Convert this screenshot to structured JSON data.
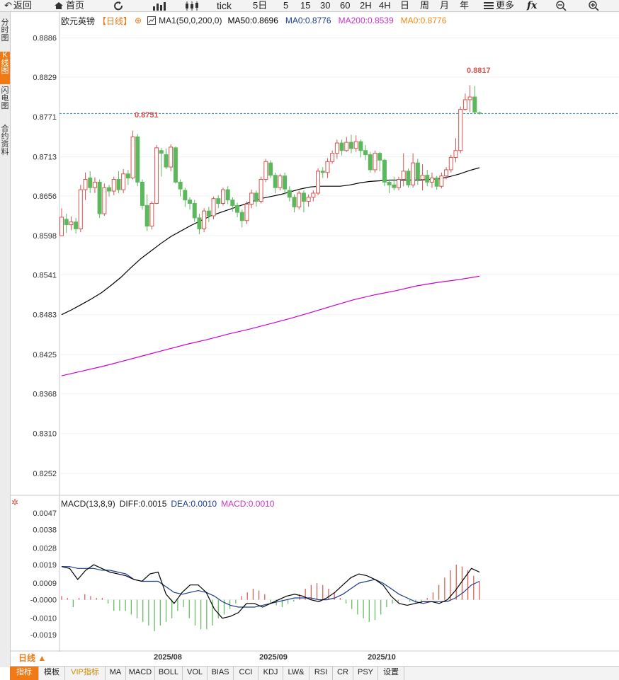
{
  "toolbar": {
    "back": "返回",
    "home": "首页",
    "tick": "tick",
    "periods": [
      "5日",
      "5",
      "15",
      "30",
      "60",
      "2H",
      "4H",
      "日",
      "周",
      "月",
      "年"
    ],
    "more": "更多"
  },
  "sidebar": [
    {
      "label": "分时图",
      "active": false
    },
    {
      "label": "K线图",
      "active": true
    },
    {
      "label": "闪电图",
      "active": false
    },
    {
      "label": "合约资料",
      "active": false
    }
  ],
  "legend": {
    "symbol": "欧元英镑",
    "period": "【日线】",
    "ma1": "MA1(50,0,200,0)",
    "ma50": "MA50:0.8696",
    "ma0": "MA0:0.8776",
    "ma200": "MA200:0.8539",
    "ma0b": "MA0:0.8776"
  },
  "price_axis": [
    "0.8886",
    "0.8829",
    "0.8771",
    "0.8713",
    "0.8656",
    "0.8598",
    "0.8541",
    "0.8483",
    "0.8425",
    "0.8368",
    "0.8310",
    "0.8252"
  ],
  "annotations": {
    "high1": "0.8751",
    "high2": "0.8817"
  },
  "macd_legend": {
    "title": "MACD(13,8,9)",
    "diff": "DIFF:0.0015",
    "dea": "DEA:0.0010",
    "macd": "MACD:0.0010"
  },
  "macd_axis": [
    "0.0047",
    "0.0038",
    "0.0028",
    "0.0019",
    "0.0009",
    "-0.0000",
    "-0.0010",
    "-0.0019"
  ],
  "date_axis": [
    "2025/08",
    "2025/09",
    "2025/10"
  ],
  "period_tag": "日线 ▲",
  "bottom_tabs": [
    "指标",
    "模板",
    "VIP指标",
    "MA",
    "MACD",
    "BOLL",
    "VOL",
    "BIAS",
    "CCI",
    "KDJ",
    "LW&",
    "RSI",
    "CR",
    "PSY",
    "设置"
  ],
  "colors": {
    "up": "#d9534f",
    "down": "#5cb85c",
    "ma50": "#000000",
    "ma200": "#cc00cc",
    "ma0": "#1a3c8f",
    "accent": "#ef7a16"
  },
  "chart_data": {
    "type": "candlestick",
    "price_range": [
      0.822,
      0.89
    ],
    "candles": [
      [
        0.8598,
        0.8625,
        0.8598,
        0.8638
      ],
      [
        0.8622,
        0.8614,
        0.8602,
        0.863
      ],
      [
        0.8614,
        0.8618,
        0.8606,
        0.8626
      ],
      [
        0.8618,
        0.8608,
        0.8601,
        0.8624
      ],
      [
        0.8608,
        0.8665,
        0.8603,
        0.8672
      ],
      [
        0.8665,
        0.868,
        0.865,
        0.869
      ],
      [
        0.8682,
        0.8668,
        0.866,
        0.8692
      ],
      [
        0.8668,
        0.8676,
        0.866,
        0.8683
      ],
      [
        0.8676,
        0.863,
        0.8624,
        0.868
      ],
      [
        0.863,
        0.8668,
        0.8627,
        0.8674
      ],
      [
        0.8668,
        0.8663,
        0.8655,
        0.8672
      ],
      [
        0.8663,
        0.868,
        0.8657,
        0.8684
      ],
      [
        0.868,
        0.8665,
        0.866,
        0.8692
      ],
      [
        0.8665,
        0.8688,
        0.866,
        0.8695
      ],
      [
        0.8688,
        0.8682,
        0.8672,
        0.8694
      ],
      [
        0.8682,
        0.8742,
        0.868,
        0.8751
      ],
      [
        0.8742,
        0.8676,
        0.867,
        0.8746
      ],
      [
        0.8676,
        0.8642,
        0.8636,
        0.868
      ],
      [
        0.8642,
        0.8612,
        0.8605,
        0.8658
      ],
      [
        0.8612,
        0.8645,
        0.8607,
        0.8648
      ],
      [
        0.8645,
        0.8726,
        0.8644,
        0.873
      ],
      [
        0.8722,
        0.8718,
        0.8684,
        0.8726
      ],
      [
        0.8716,
        0.8698,
        0.8695,
        0.8725
      ],
      [
        0.8698,
        0.8727,
        0.8692,
        0.8731
      ],
      [
        0.8726,
        0.8676,
        0.8674,
        0.8728
      ],
      [
        0.8676,
        0.8666,
        0.8655,
        0.868
      ],
      [
        0.8664,
        0.865,
        0.864,
        0.8668
      ],
      [
        0.865,
        0.8645,
        0.8636,
        0.8654
      ],
      [
        0.8645,
        0.8624,
        0.8618,
        0.865
      ],
      [
        0.8624,
        0.8608,
        0.86,
        0.863
      ],
      [
        0.8608,
        0.8634,
        0.8603,
        0.8638
      ],
      [
        0.8634,
        0.8627,
        0.8618,
        0.864
      ],
      [
        0.8627,
        0.8652,
        0.8622,
        0.8655
      ],
      [
        0.8652,
        0.8645,
        0.8638,
        0.8657
      ],
      [
        0.8645,
        0.8665,
        0.8642,
        0.8668
      ],
      [
        0.8665,
        0.865,
        0.8644,
        0.867
      ],
      [
        0.865,
        0.8642,
        0.8633,
        0.8654
      ],
      [
        0.8642,
        0.8632,
        0.8625,
        0.8646
      ],
      [
        0.8632,
        0.862,
        0.861,
        0.8636
      ],
      [
        0.862,
        0.8644,
        0.8615,
        0.8648
      ],
      [
        0.8644,
        0.866,
        0.8638,
        0.8665
      ],
      [
        0.866,
        0.8648,
        0.864,
        0.8664
      ],
      [
        0.8648,
        0.868,
        0.8645,
        0.8684
      ],
      [
        0.868,
        0.8706,
        0.8676,
        0.871
      ],
      [
        0.8704,
        0.8686,
        0.8682,
        0.8708
      ],
      [
        0.8686,
        0.8668,
        0.866,
        0.869
      ],
      [
        0.8668,
        0.8685,
        0.8664,
        0.8688
      ],
      [
        0.8685,
        0.8666,
        0.8658,
        0.869
      ],
      [
        0.8664,
        0.8654,
        0.8648,
        0.867
      ],
      [
        0.8654,
        0.864,
        0.8632,
        0.8658
      ],
      [
        0.864,
        0.866,
        0.8636,
        0.8663
      ],
      [
        0.866,
        0.8648,
        0.8632,
        0.8664
      ],
      [
        0.8648,
        0.8654,
        0.864,
        0.8658
      ],
      [
        0.8654,
        0.866,
        0.8648,
        0.8664
      ],
      [
        0.866,
        0.8692,
        0.8657,
        0.8696
      ],
      [
        0.8692,
        0.869,
        0.8682,
        0.8698
      ],
      [
        0.869,
        0.8706,
        0.8682,
        0.8711
      ],
      [
        0.8706,
        0.8718,
        0.8703,
        0.8722
      ],
      [
        0.8718,
        0.8733,
        0.871,
        0.8738
      ],
      [
        0.8733,
        0.8722,
        0.8715,
        0.8738
      ],
      [
        0.8722,
        0.8734,
        0.872,
        0.8742
      ],
      [
        0.8734,
        0.8725,
        0.8718,
        0.8745
      ],
      [
        0.8725,
        0.8735,
        0.872,
        0.8744
      ],
      [
        0.8735,
        0.8722,
        0.8712,
        0.8738
      ],
      [
        0.8722,
        0.8716,
        0.8708,
        0.873
      ],
      [
        0.8716,
        0.8694,
        0.869,
        0.872
      ],
      [
        0.8694,
        0.8718,
        0.869,
        0.8722
      ],
      [
        0.8718,
        0.8708,
        0.8692,
        0.872
      ],
      [
        0.8708,
        0.8676,
        0.867,
        0.871
      ],
      [
        0.8676,
        0.8672,
        0.866,
        0.868
      ],
      [
        0.8672,
        0.8668,
        0.8664,
        0.8684
      ],
      [
        0.8668,
        0.868,
        0.8664,
        0.8684
      ],
      [
        0.868,
        0.8692,
        0.867,
        0.8718
      ],
      [
        0.8692,
        0.8672,
        0.8668,
        0.8696
      ],
      [
        0.8672,
        0.8704,
        0.8668,
        0.8718
      ],
      [
        0.8704,
        0.868,
        0.8672,
        0.871
      ],
      [
        0.868,
        0.8686,
        0.8664,
        0.8702
      ],
      [
        0.8686,
        0.8676,
        0.867,
        0.8694
      ],
      [
        0.8676,
        0.8682,
        0.8668,
        0.869
      ],
      [
        0.8682,
        0.867,
        0.8665,
        0.8685
      ],
      [
        0.867,
        0.8685,
        0.8667,
        0.869
      ],
      [
        0.8685,
        0.8694,
        0.868,
        0.8698
      ],
      [
        0.8694,
        0.8712,
        0.869,
        0.8716
      ],
      [
        0.8712,
        0.8722,
        0.8705,
        0.874
      ],
      [
        0.8722,
        0.8782,
        0.8718,
        0.8786
      ],
      [
        0.8782,
        0.8796,
        0.878,
        0.8805
      ],
      [
        0.8796,
        0.88,
        0.8778,
        0.8817
      ],
      [
        0.88,
        0.8778,
        0.8775,
        0.8816
      ],
      [
        0.8777,
        0.8776,
        0.8774,
        0.8779
      ]
    ],
    "ma50": [
      0.8483,
      0.849,
      0.8498,
      0.8506,
      0.8515,
      0.8526,
      0.8538,
      0.8552,
      0.8565,
      0.8576,
      0.8587,
      0.8597,
      0.8605,
      0.8613,
      0.862,
      0.8627,
      0.8632,
      0.8637,
      0.8642,
      0.8647,
      0.8652,
      0.8655,
      0.8658,
      0.8662,
      0.8666,
      0.8669,
      0.867,
      0.867,
      0.867,
      0.8672,
      0.8675,
      0.8677,
      0.8678,
      0.8679,
      0.8679,
      0.8679,
      0.8679,
      0.868,
      0.8681,
      0.8684,
      0.8688,
      0.8693,
      0.8697
    ],
    "ma200": [
      0.8394,
      0.8401,
      0.8408,
      0.8416,
      0.8424,
      0.8432,
      0.844,
      0.8447,
      0.8455,
      0.8462,
      0.847,
      0.8478,
      0.8487,
      0.8496,
      0.8505,
      0.8512,
      0.8518,
      0.8525,
      0.853,
      0.8534,
      0.8539
    ],
    "ma0_level": 0.8776,
    "macd_range": [
      -0.0027,
      0.0052
    ],
    "diff": [
      0.0018,
      0.0017,
      0.0011,
      0.0016,
      0.0019,
      0.0017,
      0.0015,
      0.0014,
      0.0013,
      0.0011,
      0.001,
      0.0014,
      0.0015,
      0.0003,
      -0.0002,
      0.0004,
      0.0008,
      0.0008,
      0.0004,
      -0.0005,
      -0.001,
      -0.0009,
      -0.0007,
      -0.0002,
      -0.0002,
      -0.0004,
      -0.0002,
      0.0,
      0.0002,
      0.0003,
      0.0002,
      0.0,
      -0.0001,
      0.0001,
      0.0004,
      0.0008,
      0.0012,
      0.0014,
      0.0013,
      0.0011,
      0.0008,
      0.0002,
      -0.0002,
      -0.0003,
      -0.0002,
      -0.0001,
      -0.0001,
      -0.0002,
      0.0,
      0.0005,
      0.0011,
      0.0017,
      0.0015
    ],
    "dea": [
      0.0018,
      0.0018,
      0.0017,
      0.0017,
      0.0017,
      0.0016,
      0.0016,
      0.0015,
      0.0014,
      0.0011,
      0.001,
      0.001,
      0.001,
      0.0007,
      0.0004,
      0.0003,
      0.0004,
      0.0005,
      0.0004,
      0.0002,
      -0.0001,
      -0.0003,
      -0.0004,
      -0.0004,
      -0.0004,
      -0.0003,
      -0.0002,
      -0.0001,
      0.0,
      0.0001,
      0.0001,
      0.0001,
      0.0,
      0.0,
      0.0001,
      0.0003,
      0.0006,
      0.0009,
      0.001,
      0.0011,
      0.0009,
      0.0006,
      0.0003,
      0.0001,
      -0.0001,
      -0.0002,
      -0.0001,
      -0.0001,
      -0.0001,
      0.0001,
      0.0004,
      0.0008,
      0.001
    ],
    "macd_hist": [
      0.0002,
      0.0001,
      -0.0004,
      0.0001,
      0.0003,
      0.0002,
      0.0001,
      0.0001,
      -0.0002,
      -0.0006,
      -0.0006,
      -0.0006,
      -0.0008,
      -0.001,
      -0.0012,
      -0.0014,
      -0.0017,
      -0.0014,
      -0.0012,
      -0.001,
      -0.0006,
      -0.0004,
      -0.001,
      -0.0014,
      -0.0016,
      -0.0016,
      -0.0014,
      -0.001,
      -0.0008,
      -0.0005,
      -0.0002,
      0.0002,
      0.0004,
      0.0006,
      0.0005,
      0.0003,
      -0.0002,
      -0.0003,
      -0.0004,
      -0.0002,
      -0.0001,
      0.0003,
      0.0006,
      0.0008,
      0.0009,
      0.0008,
      0.0006,
      0.0004,
      0.0001,
      -0.0002,
      -0.0005,
      -0.0008,
      -0.001,
      -0.0012,
      -0.0011,
      -0.0008,
      -0.0004,
      -0.0002,
      -0.0001,
      0.0,
      -0.0001,
      -0.0002,
      -0.0002,
      0.0001,
      0.0004,
      0.0008,
      0.0012,
      0.0016,
      0.0019,
      0.0018,
      0.0016,
      0.0013,
      0.001
    ]
  }
}
